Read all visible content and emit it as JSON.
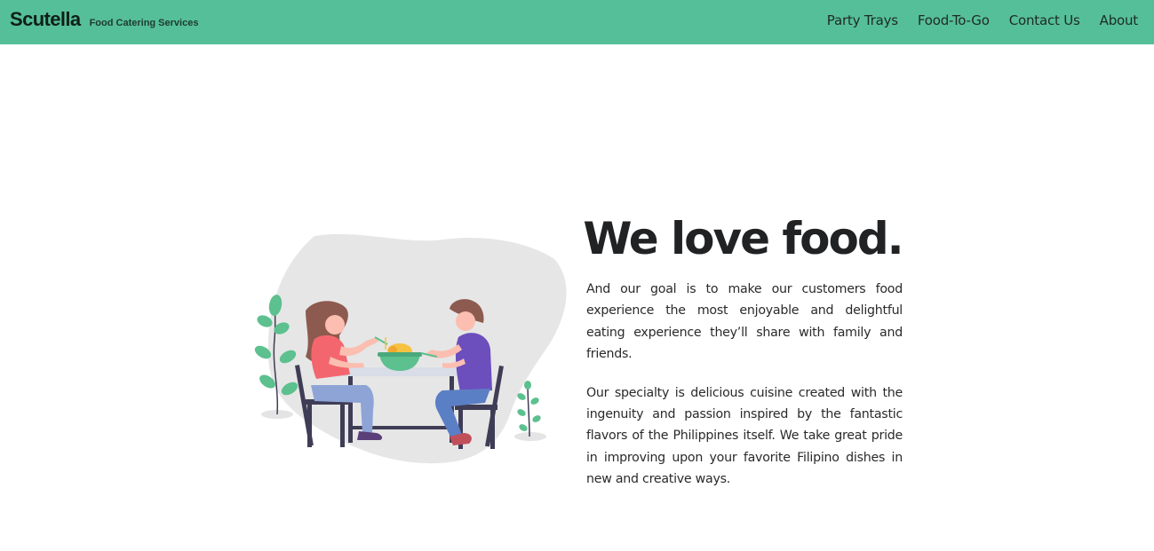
{
  "header": {
    "brand_name": "Scutella",
    "tagline": "Food Catering Services",
    "nav": [
      {
        "label": "Party Trays"
      },
      {
        "label": "Food-To-Go"
      },
      {
        "label": "Contact Us"
      },
      {
        "label": "About"
      }
    ]
  },
  "hero": {
    "title": "We love food.",
    "paragraph_1": "And our goal is to make our customers food experience the most enjoyable and delightful eating experience they’ll share with family and friends.",
    "paragraph_2": "Our specialty is delicious cuisine created with the ingenuity and passion inspired by the fantastic flavors of the Philippines itself. We take great pride in improving upon your favorite Filipino dishes in new and creative ways.",
    "illustration": "couple-sharing-meal-illustration"
  },
  "colors": {
    "nav_background": "#55bf9a",
    "accent_green": "#5cc08f",
    "blob_gray": "#e6e6e6"
  }
}
